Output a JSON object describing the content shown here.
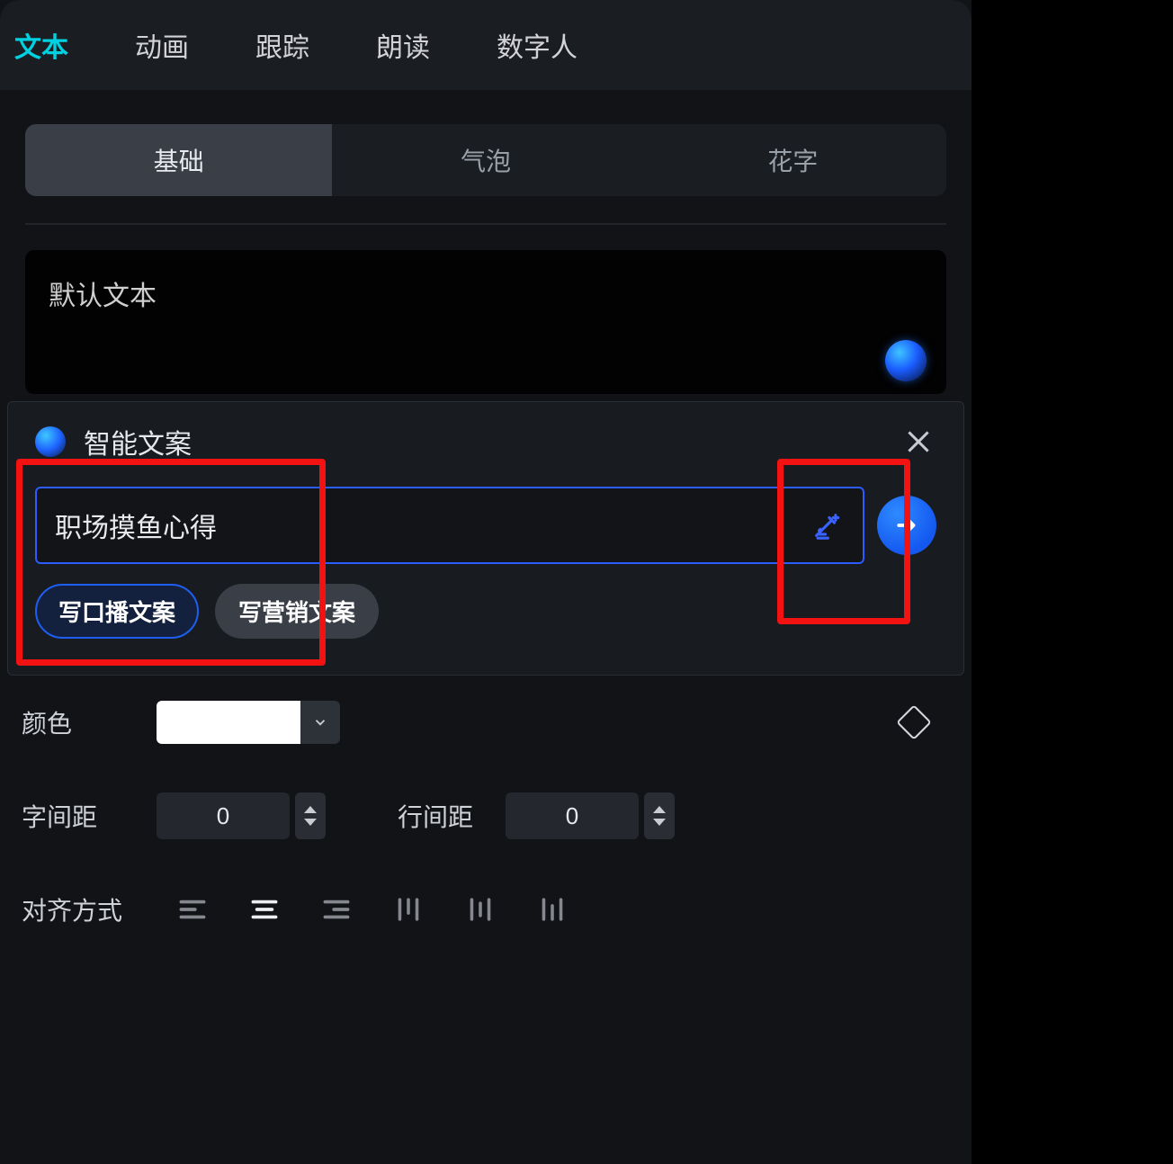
{
  "topTabs": {
    "items": [
      "文本",
      "动画",
      "跟踪",
      "朗读",
      "数字人"
    ],
    "active": 0
  },
  "subTabs": {
    "items": [
      "基础",
      "气泡",
      "花字"
    ],
    "active": 0
  },
  "textContent": "默认文本",
  "popup": {
    "title": "智能文案",
    "input": "职场摸鱼心得",
    "chips": [
      "写口播文案",
      "写营销文案"
    ],
    "activeChip": 0
  },
  "props": {
    "colorLabel": "颜色",
    "colorValue": "#FFFFFF",
    "letterSpacingLabel": "字间距",
    "letterSpacing": "0",
    "lineSpacingLabel": "行间距",
    "lineSpacing": "0",
    "alignLabel": "对齐方式"
  }
}
